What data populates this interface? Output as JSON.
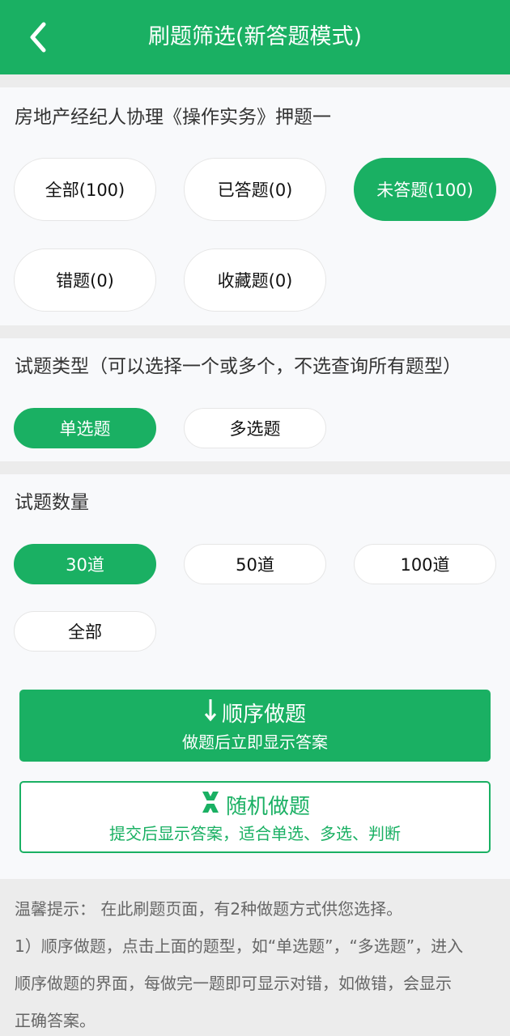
{
  "header": {
    "title": "刷题筛选(新答题模式)"
  },
  "scope": {
    "label": "房地产经纪人协理《操作实务》押题一",
    "options": [
      "全部(100)",
      "已答题(0)",
      "未答题(100)",
      "错题(0)",
      "收藏题(0)"
    ],
    "selected": "未答题(100)"
  },
  "type": {
    "label": "试题类型（可以选择一个或多个，不选查询所有题型）",
    "options": [
      "单选题",
      "多选题"
    ],
    "selected": "单选题"
  },
  "count": {
    "label": "试题数量",
    "options": [
      "30道",
      "50道",
      "100道",
      "全部"
    ],
    "selected": "30道"
  },
  "sequential": {
    "title": "顺序做题",
    "subtitle": "做题后立即显示答案",
    "icon": "arrow-down-icon"
  },
  "random": {
    "title": "随机做题",
    "subtitle": "提交后显示答案，适合单选、多选、判断",
    "icon": "shuffle-icon"
  },
  "tips": {
    "lines": [
      "温馨提示： 在此刷题页面，有2种做题方式供您选择。",
      "1）顺序做题，点击上面的题型，如“单选题”，“多选题”，进入",
      "顺序做题的界面，每做完一题即可显示对错，如做错，会显示",
      "正确答案。"
    ]
  },
  "colors": {
    "accent": "#1ab063",
    "pageBg": "#ececec",
    "cardBg": "#f8f9fb"
  }
}
